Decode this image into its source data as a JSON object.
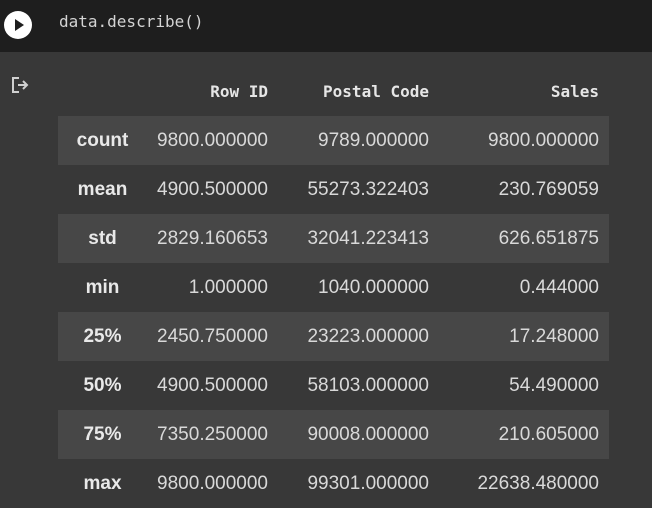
{
  "code": {
    "text": "data.describe()"
  },
  "icons": {
    "run": "play-circle-icon",
    "output": "output-arrow-icon"
  },
  "table": {
    "columns": [
      "Row ID",
      "Postal Code",
      "Sales"
    ],
    "rows": [
      {
        "label": "count",
        "values": [
          "9800.000000",
          "9789.000000",
          "9800.000000"
        ]
      },
      {
        "label": "mean",
        "values": [
          "4900.500000",
          "55273.322403",
          "230.769059"
        ]
      },
      {
        "label": "std",
        "values": [
          "2829.160653",
          "32041.223413",
          "626.651875"
        ]
      },
      {
        "label": "min",
        "values": [
          "1.000000",
          "1040.000000",
          "0.444000"
        ]
      },
      {
        "label": "25%",
        "values": [
          "2450.750000",
          "23223.000000",
          "17.248000"
        ]
      },
      {
        "label": "50%",
        "values": [
          "4900.500000",
          "58103.000000",
          "54.490000"
        ]
      },
      {
        "label": "75%",
        "values": [
          "7350.250000",
          "90008.000000",
          "210.605000"
        ]
      },
      {
        "label": "max",
        "values": [
          "9800.000000",
          "99301.000000",
          "22638.480000"
        ]
      }
    ]
  },
  "colors": {
    "background": "#383838",
    "code_background": "#1e1e1e",
    "row_stripe": "#474747",
    "text": "#d9d9d9"
  }
}
